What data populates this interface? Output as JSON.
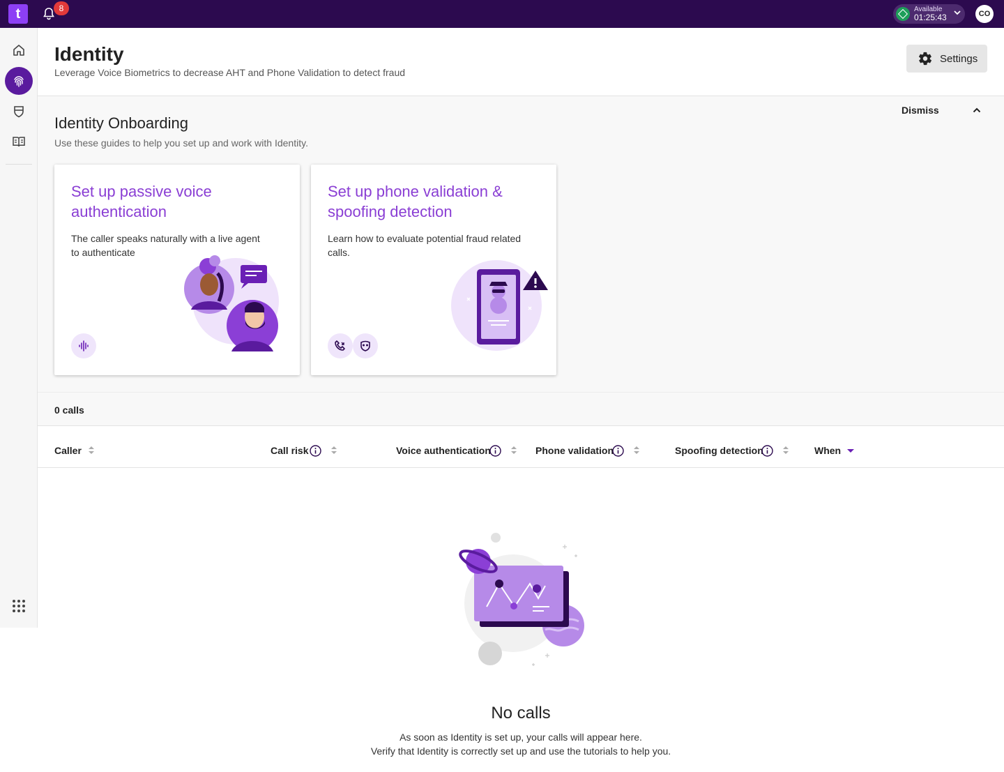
{
  "topbar": {
    "logo_text": "t",
    "notifications_count": "8",
    "status_label": "Available",
    "status_time": "01:25:43",
    "user_initials": "CO"
  },
  "sidebar": {
    "items": [
      {
        "icon": "home-icon"
      },
      {
        "icon": "fingerprint-icon",
        "active": true
      },
      {
        "icon": "shield-icon"
      },
      {
        "icon": "book-icon"
      }
    ],
    "apps_icon": "apps-grid-icon"
  },
  "header": {
    "title": "Identity",
    "subtitle": "Leverage Voice Biometrics to decrease AHT and Phone Validation to detect fraud",
    "settings_label": "Settings"
  },
  "onboarding": {
    "title": "Identity Onboarding",
    "subtitle": "Use these guides to help you set up and work with Identity.",
    "dismiss_label": "Dismiss",
    "cards": [
      {
        "title": "Set up passive voice authentication",
        "text": "The caller speaks naturally with a live agent to authenticate",
        "chips": [
          "voice-wave-icon"
        ]
      },
      {
        "title": "Set up phone validation & spoofing detection",
        "text": "Learn how to evaluate potential fraud related calls.",
        "chips": [
          "phone-call-icon",
          "spoof-mask-icon"
        ]
      }
    ]
  },
  "calls": {
    "count_label": "0 calls",
    "columns": [
      {
        "label": "Caller",
        "info": false,
        "sort": "none"
      },
      {
        "label": "Call risk",
        "info": true,
        "sort": "none"
      },
      {
        "label": "Voice authentication",
        "info": true,
        "sort": "none"
      },
      {
        "label": "Phone validation",
        "info": true,
        "sort": "none"
      },
      {
        "label": "Spoofing detection",
        "info": true,
        "sort": "none"
      },
      {
        "label": "When",
        "info": false,
        "sort": "desc"
      }
    ],
    "empty": {
      "title": "No calls",
      "line1": "As soon as Identity is set up, your calls will appear here.",
      "line2": "Verify that Identity is correctly set up and use the tutorials to help you."
    }
  },
  "colors": {
    "topbar": "#2c0a4f",
    "accent": "#8a3ed4",
    "active_nav": "#5a1b9e",
    "status_green": "#1e9e5a",
    "badge_red": "#e23a3a"
  }
}
